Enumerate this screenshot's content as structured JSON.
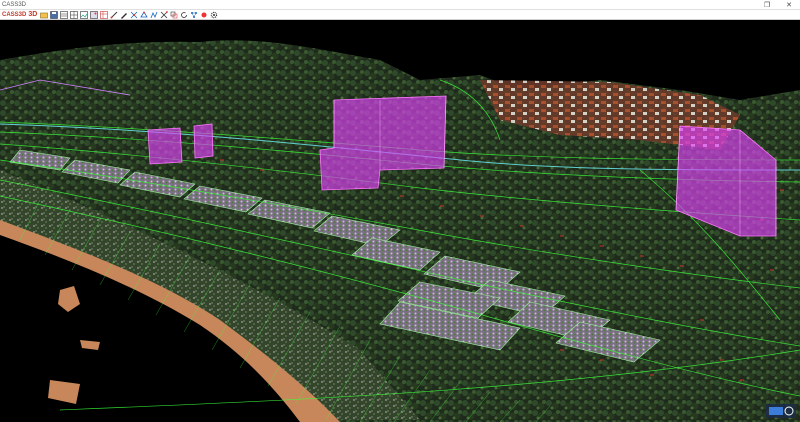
{
  "window": {
    "title": "CASS3D",
    "restore_glyph": "❐",
    "close_glyph": "✕"
  },
  "toolbar": {
    "app_label": "CASS3D",
    "mode_label": "3D",
    "tools": [
      "open-file-icon",
      "save-icon",
      "layers-icon",
      "grid-icon",
      "image-icon",
      "picture-icon",
      "table-icon",
      "measure-icon",
      "pen-icon",
      "node-edit-icon",
      "vertex-icon",
      "polyline-icon",
      "split-icon",
      "merge-icon",
      "rotate-icon",
      "network-icon",
      "record-icon",
      "settings-icon"
    ]
  },
  "colors": {
    "toolbar_accent": "#c0392b",
    "highlight_box": "#e040fb",
    "contour_line": "#39ff39",
    "sand": "#c8875a"
  }
}
